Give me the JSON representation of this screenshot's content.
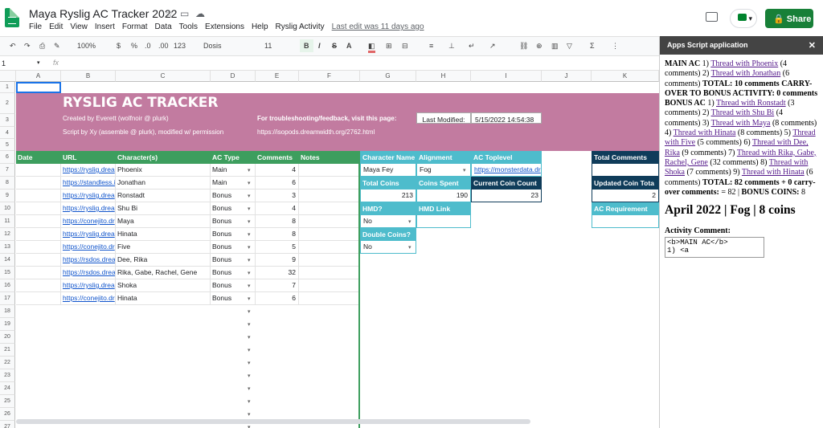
{
  "app": {
    "doc_title": "Maya Ryslig AC Tracker 2022",
    "menu": [
      "File",
      "Edit",
      "View",
      "Insert",
      "Format",
      "Data",
      "Tools",
      "Extensions",
      "Help",
      "Ryslig Activity"
    ],
    "last_edit": "Last edit was 11 days ago",
    "share_label": "Share"
  },
  "toolbar": {
    "zoom": "100%",
    "currency": "$",
    "percent": "%",
    "dec0": ".0",
    "dec00": ".00",
    "format": "123",
    "font": "Dosis",
    "size": "11",
    "bold": "B",
    "italic": "I",
    "strike": "S",
    "textcolor": "A"
  },
  "formula_bar": {
    "cell_ref": "1",
    "fx": "fx"
  },
  "columns": [
    "A",
    "B",
    "C",
    "D",
    "E",
    "F",
    "G",
    "H",
    "I",
    "J",
    "K"
  ],
  "rows": [
    "1",
    "2",
    "3",
    "4",
    "5",
    "6",
    "7",
    "8",
    "9",
    "10",
    "11",
    "12",
    "13",
    "14",
    "15",
    "16",
    "17",
    "18",
    "19",
    "20",
    "21",
    "22",
    "23",
    "24",
    "25",
    "26",
    "27"
  ],
  "banner": {
    "title": "RYSLIG AC TRACKER",
    "created_by": "Created by Everett (wolfnoir @ plurk)",
    "script_by": "Script by Xy (assemble @ plurk), modified w/ permission",
    "troubleshoot": "For troubleshooting/feedback, visit this page:",
    "troubleshoot_url": "https://isopods.dreamwidth.org/2762.html",
    "last_modified_label": "Last Modified:",
    "last_modified_value": "5/15/2022 14:54:38"
  },
  "table": {
    "headers": [
      "Date",
      "URL",
      "Character(s)",
      "AC Type",
      "Comments",
      "Notes"
    ],
    "rows": [
      {
        "url": "https://ryslig.drea",
        "chars": "Phoenix",
        "type": "Main",
        "comments": "4"
      },
      {
        "url": "https://standless.i",
        "chars": "Jonathan",
        "type": "Main",
        "comments": "6"
      },
      {
        "url": "https://ryslig.drea",
        "chars": "Ronstadt",
        "type": "Bonus",
        "comments": "3"
      },
      {
        "url": "https://ryslig.drea",
        "chars": "Shu Bi",
        "type": "Bonus",
        "comments": "4"
      },
      {
        "url": "https://conejito.dr",
        "chars": "Maya",
        "type": "Bonus",
        "comments": "8"
      },
      {
        "url": "https://ryslig.drea",
        "chars": "Hinata",
        "type": "Bonus",
        "comments": "8"
      },
      {
        "url": "https://conejito.dr",
        "chars": "Five",
        "type": "Bonus",
        "comments": "5"
      },
      {
        "url": "https://rsdos.drea",
        "chars": "Dee, Rika",
        "type": "Bonus",
        "comments": "9"
      },
      {
        "url": "https://rsdos.drea",
        "chars": "Rika, Gabe, Rachel, Gene",
        "type": "Bonus",
        "comments": "32"
      },
      {
        "url": "https://ryslig.drea",
        "chars": "Shoka",
        "type": "Bonus",
        "comments": "7"
      },
      {
        "url": "https://conejito.dr",
        "chars": "Hinata",
        "type": "Bonus",
        "comments": "6"
      }
    ]
  },
  "side": {
    "char_name_label": "Character Name",
    "char_name": "Maya Fey",
    "alignment_label": "Alignment",
    "alignment": "Fog",
    "toplevel_label": "AC Toplevel",
    "toplevel": "https://monsterdata.dr",
    "total_coins_label": "Total Coins",
    "total_coins": "213",
    "coins_spent_label": "Coins Spent",
    "coins_spent": "190",
    "current_coin_label": "Current Coin Count",
    "current_coin": "23",
    "hmd_label": "HMD?",
    "hmd": "No",
    "hmd_link_label": "HMD Link",
    "double_label": "Double Coins?",
    "double": "No",
    "total_comments_label": "Total Comments",
    "updated_coin_label": "Updated Coin Tota",
    "updated_coin_val": "2",
    "ac_req_label": "AC Requirement"
  },
  "panel": {
    "title": "Apps Script application",
    "close": "✕",
    "main_ac": "MAIN AC",
    "t1": "Thread with Phoenix",
    "c1": "(4 comments)",
    "t2": "Thread with Jonathan",
    "c2": "(6 comments)",
    "total1": "TOTAL: 10 comments",
    "carry": "CARRY-OVER TO BONUS ACTIVITY: 0 comments",
    "bonus_ac": "BONUS AC",
    "b1": "Thread with Ronstadt",
    "bc1": "(3 comments)",
    "b2": "Thread with Shu Bi",
    "bc2": "(4 comments)",
    "b3": "Thread with Maya",
    "bc3": "(8 comments)",
    "b4": "Thread with Hinata",
    "bc4": "(8 comments)",
    "b5": "Thread with Five",
    "bc5": "(5 comments)",
    "b6": "Thread with Dee, Rika",
    "bc6": "(9 comments)",
    "b7": "Thread with Rika, Gabe, Rachel, Gene",
    "bc7": "(32 comments)",
    "b8": "Thread with Shoka",
    "bc8": "(7 comments)",
    "b9": "Thread with Hinata",
    "bc9": "(6 comments)",
    "total2": "TOTAL: 82 comments + 0 carry-over comments:",
    "eq": "= 82 | ",
    "bonus_coins": "BONUS COINS:",
    "bonus_coins_val": "8",
    "month": "April 2022 | Fog | 8 coins",
    "activity_label": "Activity Comment:",
    "activity_text": "<b>MAIN AC</b>\n1) <a"
  }
}
